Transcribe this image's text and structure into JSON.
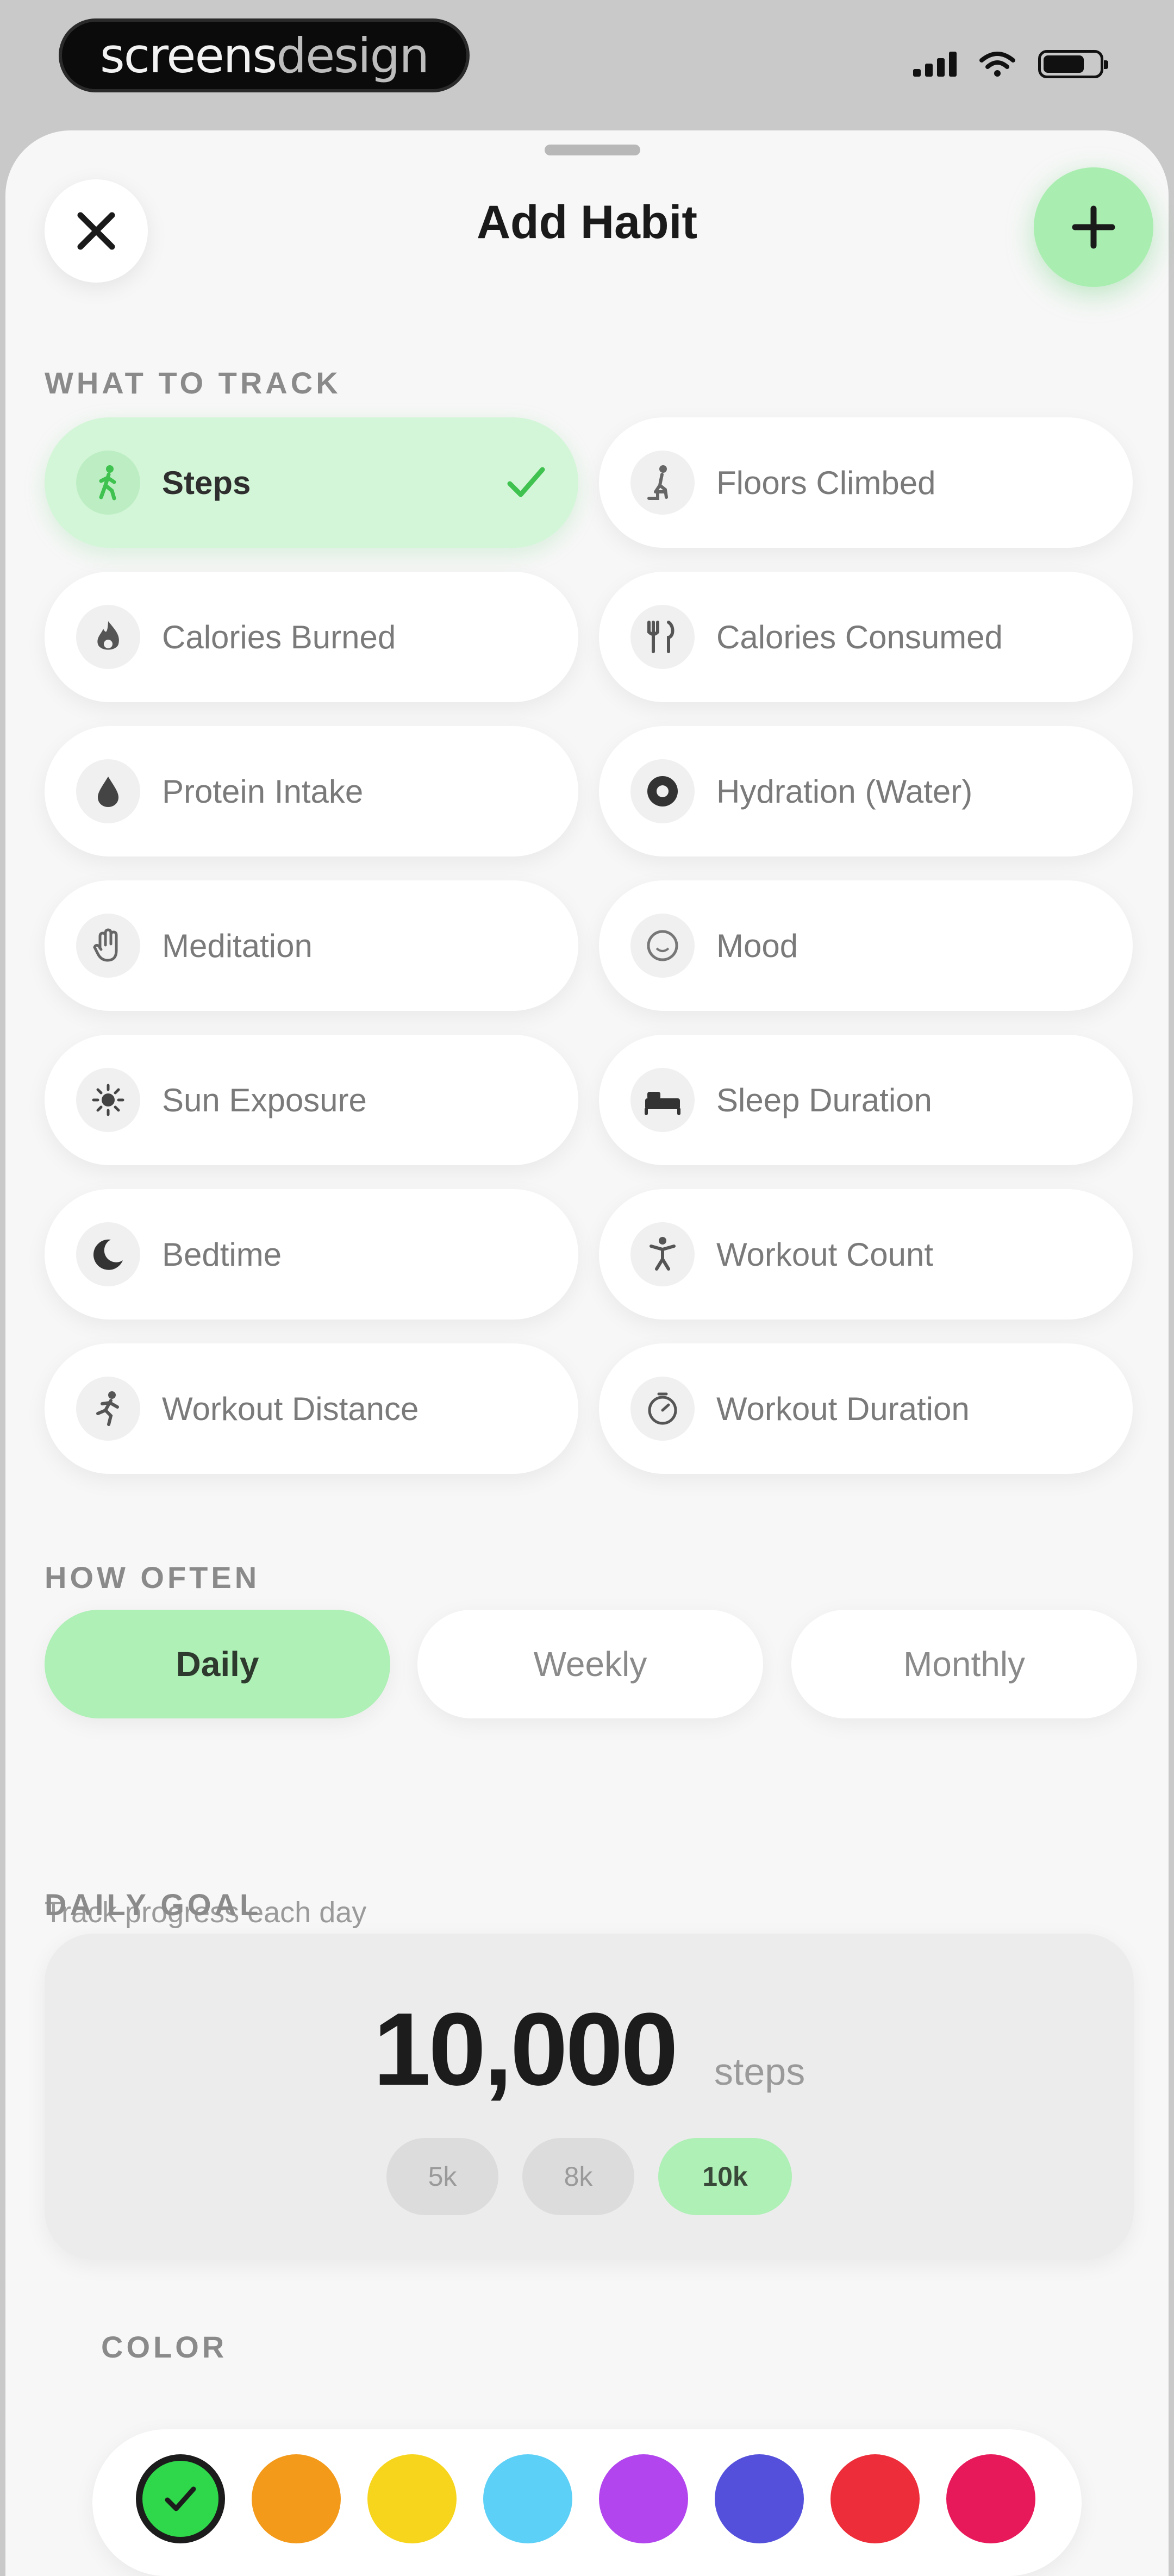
{
  "status_bar": {
    "brand_bold": "screens",
    "brand_light": "design"
  },
  "header": {
    "title": "Add Habit"
  },
  "sections": {
    "what_to_track": "WHAT TO TRACK",
    "how_often": "HOW OFTEN",
    "daily_goal": "DAILY GOAL",
    "color": "COLOR"
  },
  "track_options": [
    {
      "label": "Steps",
      "icon": "walking-icon",
      "selected": true
    },
    {
      "label": "Floors Climbed",
      "icon": "stairs-icon",
      "selected": false
    },
    {
      "label": "Calories Burned",
      "icon": "flame-icon",
      "selected": false
    },
    {
      "label": "Calories Consumed",
      "icon": "fork-knife-icon",
      "selected": false
    },
    {
      "label": "Protein Intake",
      "icon": "drop-icon",
      "selected": false
    },
    {
      "label": "Hydration (Water)",
      "icon": "water-icon",
      "selected": false
    },
    {
      "label": "Meditation",
      "icon": "hand-icon",
      "selected": false
    },
    {
      "label": "Mood",
      "icon": "smiley-icon",
      "selected": false
    },
    {
      "label": "Sun Exposure",
      "icon": "sun-icon",
      "selected": false
    },
    {
      "label": "Sleep Duration",
      "icon": "bed-icon",
      "selected": false
    },
    {
      "label": "Bedtime",
      "icon": "moon-icon",
      "selected": false
    },
    {
      "label": "Workout Count",
      "icon": "figure-icon",
      "selected": false
    },
    {
      "label": "Workout Distance",
      "icon": "running-icon",
      "selected": false
    },
    {
      "label": "Workout Duration",
      "icon": "timer-icon",
      "selected": false
    }
  ],
  "frequency": {
    "options": [
      "Daily",
      "Weekly",
      "Monthly"
    ],
    "selected": "Daily",
    "hint": "Track progress each day"
  },
  "goal": {
    "value": "10,000",
    "unit": "steps",
    "presets": [
      "5k",
      "8k",
      "10k"
    ],
    "selected": "10k"
  },
  "palette": {
    "selected": "#2fd84a",
    "colors": [
      "#2fd84a",
      "#f39a1b",
      "#f7d51d",
      "#5cd0f7",
      "#b245ee",
      "#5450dc",
      "#ee2d3a",
      "#e8195a"
    ]
  },
  "theme": {
    "accent": "#aef0b6",
    "selected_tile": "#d4f6d8",
    "check": "#3fc24f"
  }
}
